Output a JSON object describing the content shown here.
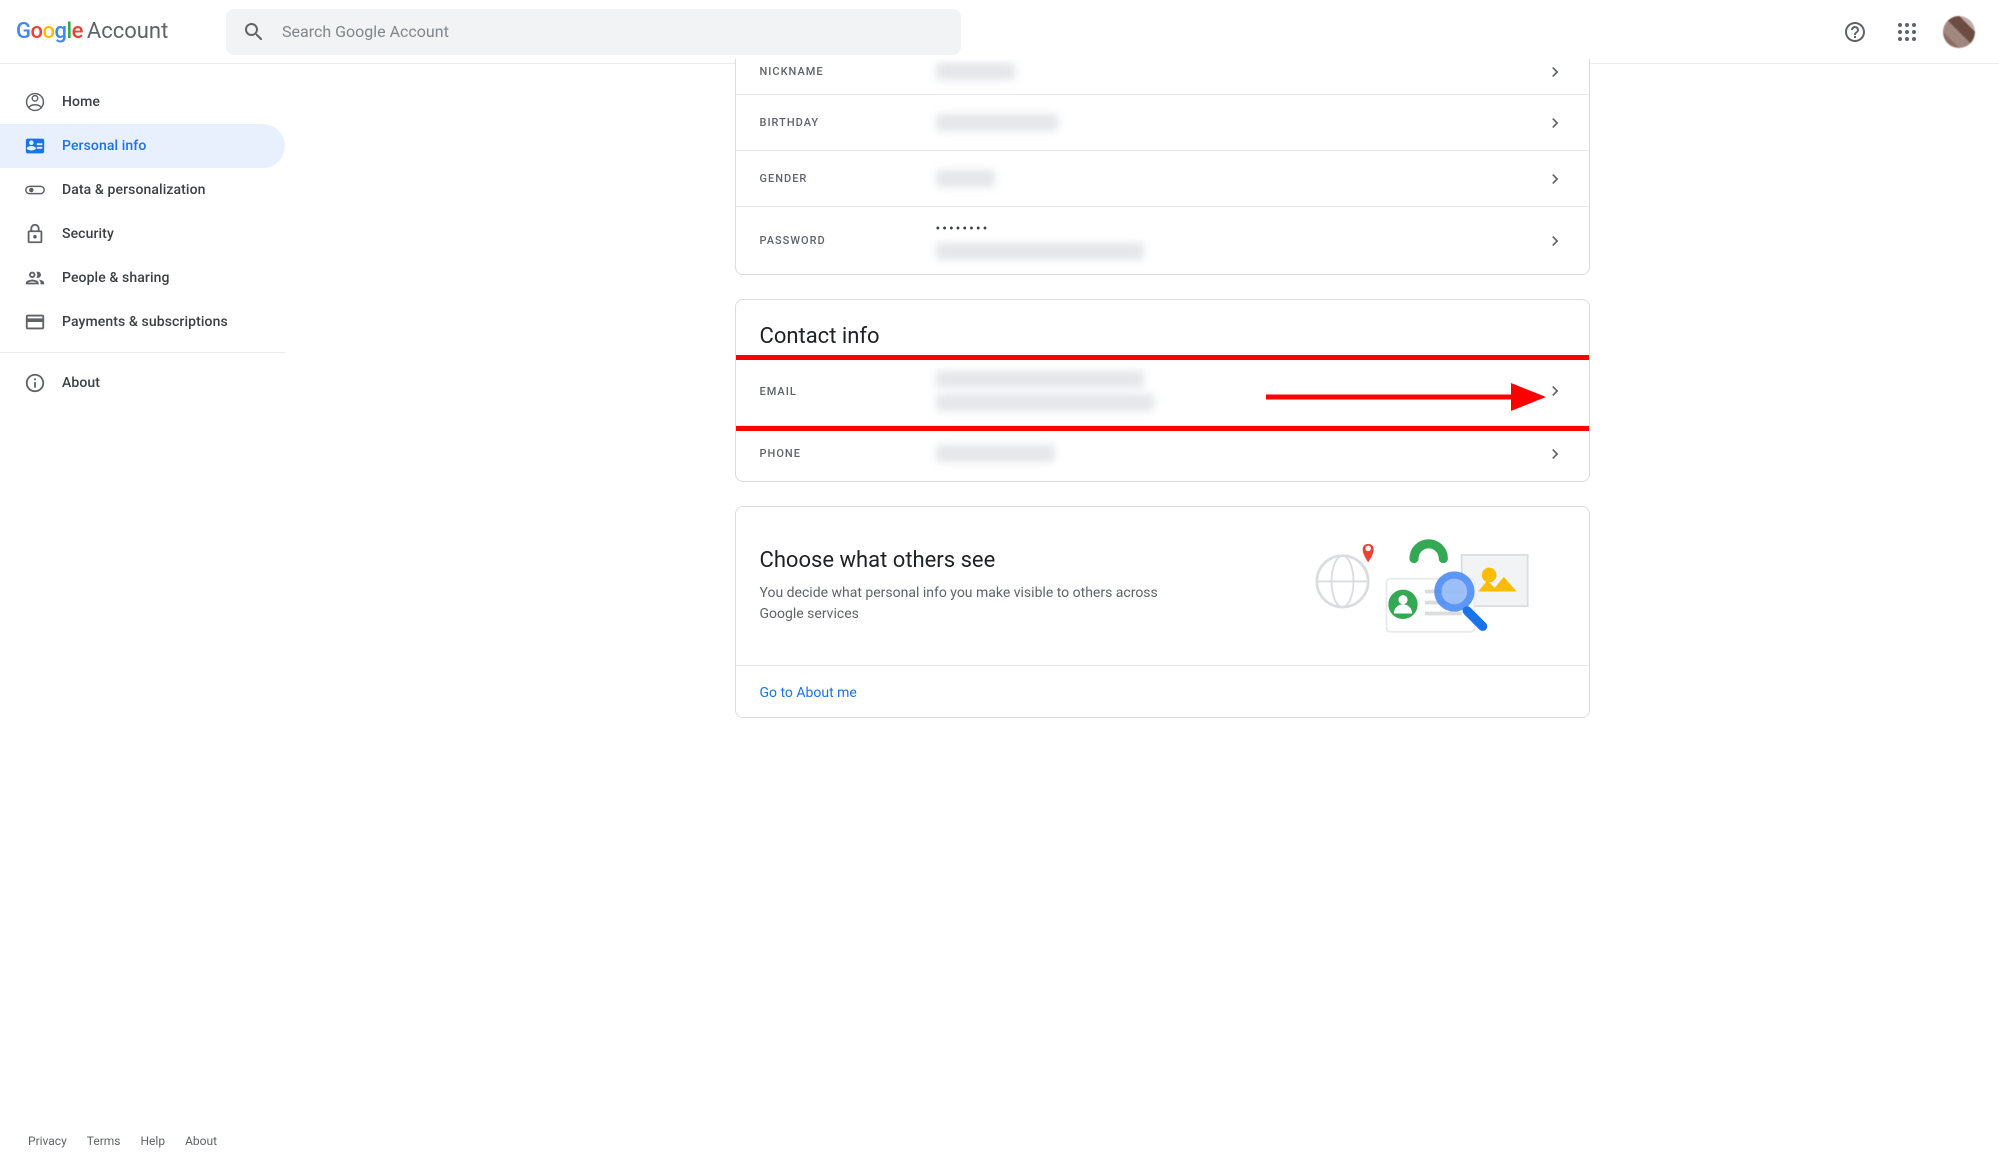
{
  "header": {
    "logo_g": "G",
    "logo_o1": "o",
    "logo_o2": "o",
    "logo_g2": "g",
    "logo_l": "l",
    "logo_e": "e",
    "logo_account": "Account",
    "search_placeholder": "Search Google Account"
  },
  "sidebar": {
    "items": [
      {
        "label": "Home",
        "icon": "home"
      },
      {
        "label": "Personal info",
        "icon": "badge",
        "active": true
      },
      {
        "label": "Data & personalization",
        "icon": "toggle"
      },
      {
        "label": "Security",
        "icon": "lock"
      },
      {
        "label": "People & sharing",
        "icon": "people"
      },
      {
        "label": "Payments & subscriptions",
        "icon": "card"
      },
      {
        "label": "About",
        "icon": "info"
      }
    ]
  },
  "basic_info": {
    "rows": [
      {
        "label": "NICKNAME",
        "values": [
          "████████"
        ],
        "redacted": [
          true
        ]
      },
      {
        "label": "BIRTHDAY",
        "values": [
          "████████ ████"
        ],
        "redacted": [
          true
        ]
      },
      {
        "label": "GENDER",
        "values": [
          "██████"
        ],
        "redacted": [
          true
        ]
      },
      {
        "label": "PASSWORD",
        "values": [
          "••••••••",
          "████ ████████ ████ ████"
        ],
        "redacted": [
          false,
          true
        ]
      }
    ]
  },
  "contact_info": {
    "title": "Contact info",
    "rows": [
      {
        "label": "EMAIL",
        "values": [
          "█████████████████████",
          "██████████████████████"
        ],
        "redacted": [
          true,
          true
        ],
        "highlighted": true
      },
      {
        "label": "PHONE",
        "values": [
          "████████████"
        ],
        "redacted": [
          true
        ]
      }
    ]
  },
  "choose": {
    "title": "Choose what others see",
    "desc": "You decide what personal info you make visible to others across Google services",
    "link": "Go to About me"
  },
  "footer": {
    "privacy": "Privacy",
    "terms": "Terms",
    "help": "Help",
    "about": "About"
  }
}
